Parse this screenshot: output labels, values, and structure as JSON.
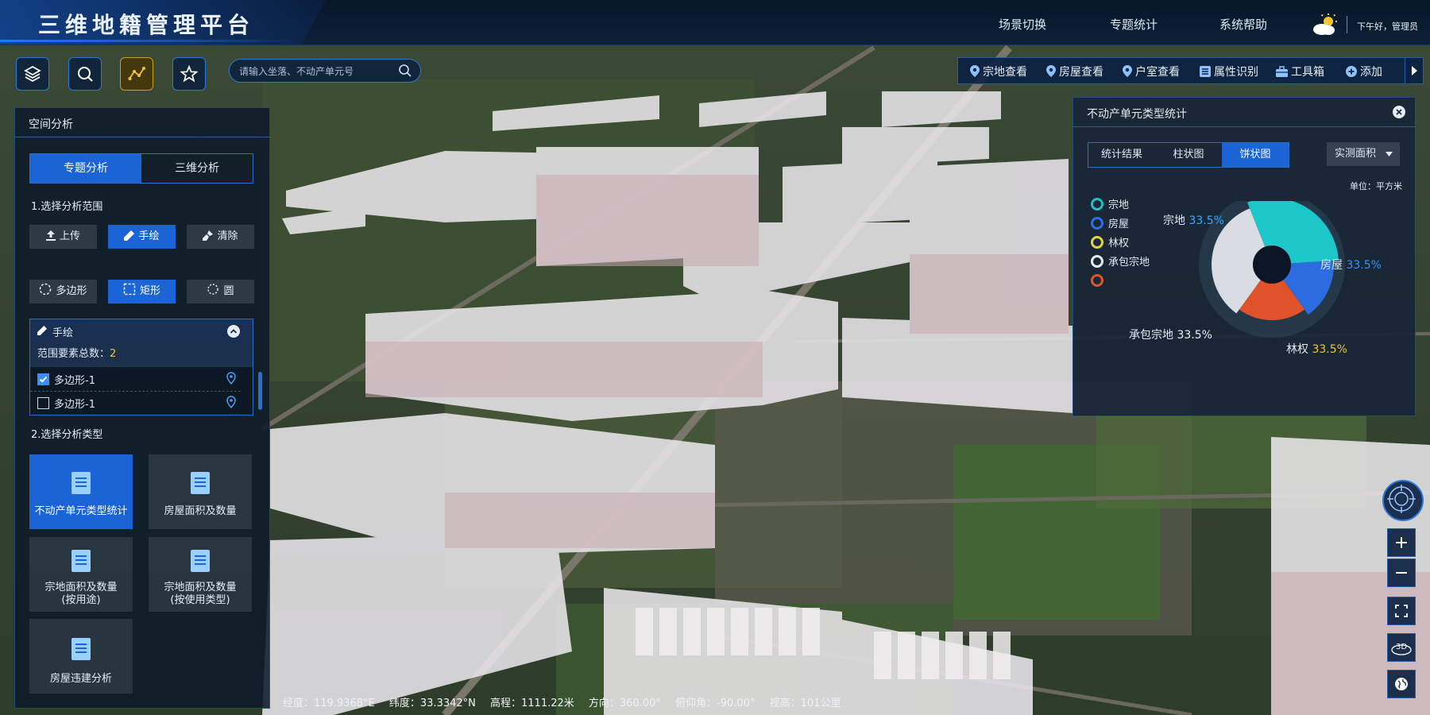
{
  "app": {
    "title": "三维地籍管理平台"
  },
  "header": {
    "nav": [
      "场景切换",
      "专题统计",
      "系统帮助"
    ],
    "greeting": "下午好，管理员"
  },
  "tools": {
    "icons": [
      "layers-icon",
      "search-magnifier-icon",
      "spatial-analysis-icon",
      "star-icon"
    ],
    "active": "spatial-analysis-icon"
  },
  "search": {
    "placeholder": "请输入坐落、不动产单元号"
  },
  "right_toolbar": {
    "items": [
      {
        "label": "宗地查看",
        "icon": "location-pin-icon"
      },
      {
        "label": "房屋查看",
        "icon": "location-pin-icon"
      },
      {
        "label": "户室查看",
        "icon": "location-pin-icon"
      },
      {
        "label": "属性识别",
        "icon": "list-icon"
      },
      {
        "label": "工具箱",
        "icon": "toolbox-icon"
      },
      {
        "label": "添加",
        "icon": "plus-circle-icon"
      }
    ]
  },
  "left_panel": {
    "title": "空间分析",
    "tabs": [
      "专题分析",
      "三维分析"
    ],
    "active_tab": "专题分析",
    "step1_label": "1.选择分析范围",
    "range_buttons": [
      "上传",
      "手绘",
      "清除"
    ],
    "range_active": "手绘",
    "shape_buttons": [
      "多边形",
      "矩形",
      "圆"
    ],
    "shape_active": "矩形",
    "draw_box": {
      "title": "手绘",
      "count_label": "范围要素总数：",
      "count_value": "2",
      "items": [
        {
          "label": "多边形-1",
          "checked": true
        },
        {
          "label": "多边形-1",
          "checked": false
        }
      ]
    },
    "step2_label": "2.选择分析类型",
    "analysis_types": [
      {
        "line1": "不动产单元类型统计",
        "line2": "",
        "active": true
      },
      {
        "line1": "房屋面积及数量",
        "line2": "",
        "active": false
      },
      {
        "line1": "宗地面积及数量",
        "line2": "(按用途)",
        "active": false
      },
      {
        "line1": "宗地面积及数量",
        "line2": "(按使用类型)",
        "active": false
      },
      {
        "line1": "房屋违建分析",
        "line2": "",
        "active": false
      }
    ]
  },
  "stats_panel": {
    "title": "不动产单元类型统计",
    "tabs": [
      "统计结果",
      "柱状图",
      "饼状图"
    ],
    "active_tab": "饼状图",
    "select_value": "实测面积",
    "unit": "单位：平方米",
    "legend": [
      "宗地",
      "房屋",
      "林权",
      "承包宗地",
      ""
    ]
  },
  "chart_data": {
    "type": "pie",
    "categories": [
      "宗地",
      "房屋",
      "林权",
      "承包宗地"
    ],
    "values": [
      33.5,
      33.5,
      33.5,
      33.5
    ],
    "value_labels": [
      "33.5%",
      "33.5%",
      "33.5%",
      "33.5%"
    ],
    "visual_shares": [
      0.3,
      0.16,
      0.2,
      0.34
    ],
    "colors": [
      "#1dc7c9",
      "#2d6be0",
      "#e0532a",
      "#d9dde3"
    ],
    "legend_colors": [
      "#1fc1c9",
      "#2f6ee8",
      "#e3d33a",
      "#e6e9ee",
      "#e0532a"
    ],
    "label_colors": [
      "#3ba7ff",
      "#3b8ff2",
      "#f2c531",
      "#e6eef8"
    ]
  },
  "map_controls": [
    "compass-icon",
    "zoom-in-icon",
    "zoom-out-icon",
    "fullscreen-icon",
    "3d-toggle-icon",
    "globe-icon"
  ],
  "status": {
    "lon": "经度：119.9368°E",
    "lat": "纬度：33.3342°N",
    "elev": "高程：1111.22米",
    "heading": "方向：360.00°",
    "pitch": "俯仰角：-90.00°",
    "view": "视高：101公里"
  }
}
